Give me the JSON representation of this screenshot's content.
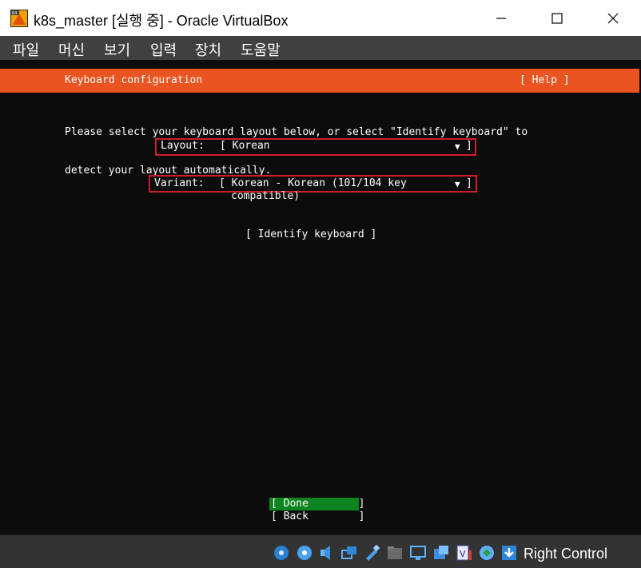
{
  "window": {
    "title": "k8s_master [실행 중] - Oracle VirtualBox",
    "controls": {
      "minimize": "─",
      "maximize": "☐",
      "close": "✕"
    }
  },
  "menu": {
    "items": [
      "파일",
      "머신",
      "보기",
      "입력",
      "장치",
      "도움말"
    ]
  },
  "installer": {
    "header_title": "Keyboard configuration",
    "help": "[ Help ]",
    "instructions": [
      "Please select your keyboard layout below, or select \"Identify keyboard\" to",
      "detect your layout automatically."
    ],
    "layout": {
      "label": "Layout:",
      "value": "[ Korean",
      "arrow": "▼",
      "close": "]"
    },
    "variant": {
      "label": "Variant:",
      "value": "[ Korean - Korean (101/104 key",
      "continuation": "compatible)",
      "arrow": "▼",
      "close": "]"
    },
    "identify_button": "[ Identify keyboard ]",
    "done_button": "[ Done        ]",
    "back_button": "[ Back        ]"
  },
  "statusbar": {
    "icons": [
      "hard-disk-icon",
      "optical-drive-icon",
      "audio-icon",
      "network-icon",
      "usb-icon",
      "shared-folder-icon",
      "display-icon",
      "capture-icon",
      "recording-icon",
      "virtualization-icon",
      "mouse-integration-icon",
      "keyboard-icon"
    ],
    "host_key": "Right Control"
  },
  "colors": {
    "header_orange": "#e95420",
    "focus_green": "#0e8420",
    "highlight_red": "#d01c2a"
  }
}
